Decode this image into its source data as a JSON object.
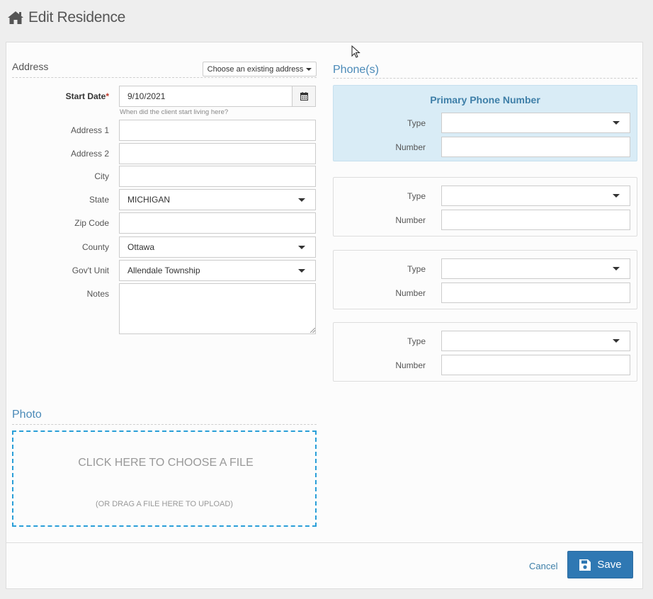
{
  "header": {
    "icon": "home-icon",
    "title": "Edit Residence"
  },
  "address": {
    "section_title": "Address",
    "choose_existing_label": "Choose an existing address",
    "start_date": {
      "label": "Start Date",
      "required_mark": "*",
      "value": "9/10/2021",
      "hint": "When did the client start living here?"
    },
    "address1": {
      "label": "Address 1",
      "value": ""
    },
    "address2": {
      "label": "Address 2",
      "value": ""
    },
    "city": {
      "label": "City",
      "value": ""
    },
    "state": {
      "label": "State",
      "value": "MICHIGAN"
    },
    "zip": {
      "label": "Zip Code",
      "value": ""
    },
    "county": {
      "label": "County",
      "value": "Ottawa"
    },
    "govt_unit": {
      "label": "Gov't Unit",
      "value": "Allendale Township"
    },
    "notes": {
      "label": "Notes",
      "value": ""
    }
  },
  "phones": {
    "section_title": "Phone(s)",
    "primary_title": "Primary Phone Number",
    "type_label": "Type",
    "number_label": "Number"
  },
  "photo": {
    "section_title": "Photo",
    "dropzone_main": "CLICK HERE TO CHOOSE A FILE",
    "dropzone_sub": "(OR DRAG A FILE HERE TO UPLOAD)"
  },
  "footer": {
    "cancel_label": "Cancel",
    "save_label": "Save"
  },
  "colors": {
    "accent": "#2f78b3",
    "primary_card": "#d9ecf6",
    "dropzone_border": "#2a9fd8",
    "required": "#c0392b"
  }
}
